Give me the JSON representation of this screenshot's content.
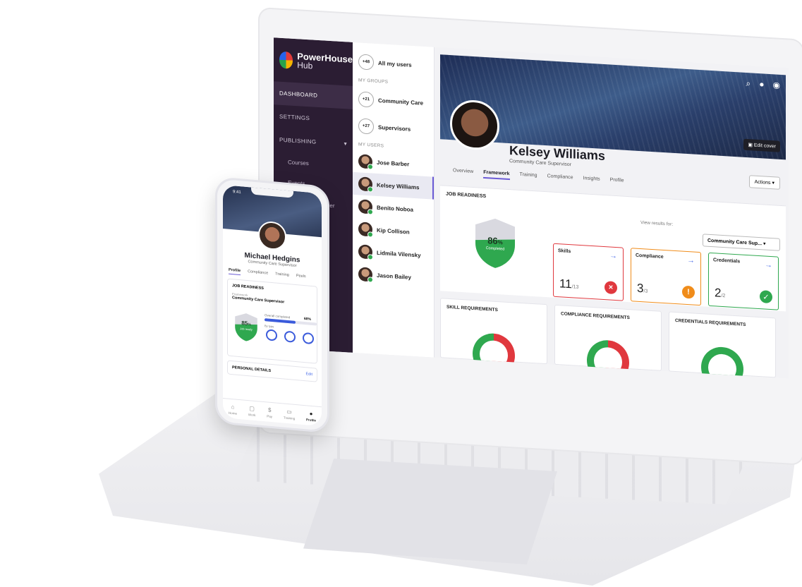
{
  "brand": {
    "name": "PowerHouse",
    "sub": "Hub"
  },
  "nav": {
    "items": [
      {
        "label": "DASHBOARD",
        "active": true
      },
      {
        "label": "SETTINGS"
      },
      {
        "label": "PUBLISHING"
      }
    ],
    "sub_items": [
      "Courses",
      "Events",
      "Workflow Manager"
    ]
  },
  "users_panel": {
    "all_users": {
      "badge": "+48",
      "label": "All my users"
    },
    "groups_label": "MY GROUPS",
    "groups": [
      {
        "badge": "+21",
        "label": "Community Care"
      },
      {
        "badge": "+27",
        "label": "Supervisors"
      }
    ],
    "users_label": "MY USERS",
    "users": [
      "Jose Barber",
      "Kelsey Williams",
      "Benito Noboa",
      "Kip Collison",
      "Lidmila Vilensky",
      "Jason Bailey"
    ]
  },
  "profile": {
    "name": "Kelsey Williams",
    "role": "Community Care Supervisor",
    "edit_cover": "Edit cover",
    "actions": "Actions",
    "tabs": [
      "Overview",
      "Framework",
      "Training",
      "Compliance",
      "Insights",
      "Profile"
    ],
    "active_tab": "Framework"
  },
  "job_readiness": {
    "title": "JOB READINESS",
    "percent_value": "86",
    "percent_sign": "%",
    "completed_label": "Completed",
    "view_results_for": "View results for:",
    "framework_select": "Community Care Sup...",
    "cards": [
      {
        "title": "Skills",
        "value": "11",
        "total": "/13",
        "status": "fail",
        "color": "#e0383e"
      },
      {
        "title": "Compliance",
        "value": "3",
        "total": "/3",
        "status": "warning",
        "color": "#f08c1a"
      },
      {
        "title": "Credentials",
        "value": "2",
        "total": "/2",
        "status": "ok",
        "color": "#2fa84f"
      }
    ]
  },
  "requirements": [
    {
      "title": "SKILL REQUIREMENTS"
    },
    {
      "title": "COMPLIANCE REQUIREMENTS"
    },
    {
      "title": "CREDENTIALS REQUIREMENTS"
    }
  ],
  "phone": {
    "time": "9:41",
    "name": "Michael Hedgins",
    "role": "Community Care Supervisor",
    "tabs": [
      "Profile",
      "Compliance",
      "Training",
      "Peels"
    ],
    "job_readiness_title": "JOB READINESS",
    "framework_label": "Framework",
    "framework": "Community Care Supervisor",
    "percent_value": "85",
    "percent_sign": "%",
    "shield_sub": "Job ready",
    "overall_label": "Overall completed",
    "overall_pct": "60%",
    "overall_value": 0.6,
    "by_type_label": "By type",
    "personal_details": "PERSONAL DETAILS",
    "edit": "Edit",
    "bottom_nav": [
      "Home",
      "Work",
      "Pay",
      "Training",
      "Profile"
    ]
  },
  "colors": {
    "accent": "#6b5bd6",
    "nav_bg": "#2b1d33",
    "link": "#4b6ee8",
    "success": "#2fa84f",
    "danger": "#e0383e",
    "warning": "#f08c1a"
  }
}
